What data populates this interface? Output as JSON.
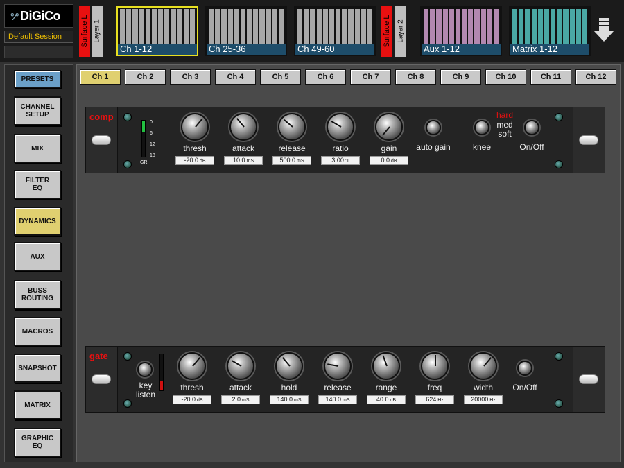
{
  "brand": {
    "logo_text": "DiGiCo",
    "logo_mark": "°⁄°"
  },
  "session": {
    "name": "Default Session"
  },
  "surfaces": [
    {
      "label": "Surface L",
      "layer": "Layer 1"
    },
    {
      "label": "Surface L",
      "layer": "Layer 2"
    }
  ],
  "banks": [
    {
      "label": "Ch 1-12",
      "color": "#a8a8a8",
      "selected": true
    },
    {
      "label": "Ch 25-36",
      "color": "#a8a8a8",
      "selected": false
    },
    {
      "label": "Ch 49-60",
      "color": "#a8a8a8",
      "selected": false
    },
    {
      "label": "Aux 1-12",
      "color": "#b288b0",
      "selected": false
    },
    {
      "label": "Matrix 1-12",
      "color": "#4aa8a4",
      "selected": false
    }
  ],
  "nav": {
    "items": [
      {
        "label": "PRESETS",
        "id": "presets"
      },
      {
        "label": "CHANNEL\nSETUP",
        "id": "channel-setup"
      },
      {
        "label": "MIX",
        "id": "mix"
      },
      {
        "label": "FILTER\nEQ",
        "id": "filter-eq"
      },
      {
        "label": "DYNAMICS",
        "id": "dynamics",
        "active": true
      },
      {
        "label": "AUX",
        "id": "aux"
      },
      {
        "label": "BUSS\nROUTING",
        "id": "buss-routing"
      },
      {
        "label": "MACROS",
        "id": "macros"
      },
      {
        "label": "SNAPSHOT",
        "id": "snapshot"
      },
      {
        "label": "MATRIX",
        "id": "matrix"
      },
      {
        "label": "GRAPHIC\nEQ",
        "id": "graphic-eq"
      }
    ]
  },
  "tabs": [
    "Ch 1",
    "Ch 2",
    "Ch 3",
    "Ch 4",
    "Ch 5",
    "Ch 6",
    "Ch 7",
    "Ch 8",
    "Ch 9",
    "Ch 10",
    "Ch 11",
    "Ch 12"
  ],
  "active_tab": 0,
  "comp": {
    "title": "comp",
    "meter": {
      "scale": [
        "0",
        "6",
        "12",
        "18"
      ],
      "label": "GR",
      "level": 0.3
    },
    "knobs": [
      {
        "name": "thresh",
        "value": "-20.0",
        "unit": "dB",
        "angle": 40
      },
      {
        "name": "attack",
        "value": "10.0",
        "unit": "mS",
        "angle": -40
      },
      {
        "name": "release",
        "value": "500.0",
        "unit": "mS",
        "angle": -50
      },
      {
        "name": "ratio",
        "value": "3.00",
        "unit": ":1",
        "angle": -60
      },
      {
        "name": "gain",
        "value": "0.0",
        "unit": "dB",
        "angle": -140
      }
    ],
    "auto_gain_label": "auto gain",
    "knee_label": "knee",
    "knee_options": [
      "hard",
      "med",
      "soft"
    ],
    "knee_selected": "hard",
    "onoff_label": "On/Off"
  },
  "gate": {
    "title": "gate",
    "key_listen_label": "key\nlisten",
    "meter": {
      "level": 0.25
    },
    "knobs": [
      {
        "name": "thresh",
        "value": "-20.0",
        "unit": "dB",
        "angle": 40
      },
      {
        "name": "attack",
        "value": "2.0",
        "unit": "mS",
        "angle": -60
      },
      {
        "name": "hold",
        "value": "140.0",
        "unit": "mS",
        "angle": -40
      },
      {
        "name": "release",
        "value": "140.0",
        "unit": "mS",
        "angle": -80
      },
      {
        "name": "range",
        "value": "40.0",
        "unit": "dB",
        "angle": -20
      },
      {
        "name": "freq",
        "value": "624",
        "unit": "Hz",
        "angle": 0
      },
      {
        "name": "width",
        "value": "20000",
        "unit": "Hz",
        "angle": 40
      }
    ],
    "onoff_label": "On/Off"
  },
  "colors": {
    "red": "#e81010",
    "accent_yellow": "#e0d070",
    "selected_border": "#e8e020",
    "label_bar": "#1e4d6a"
  }
}
